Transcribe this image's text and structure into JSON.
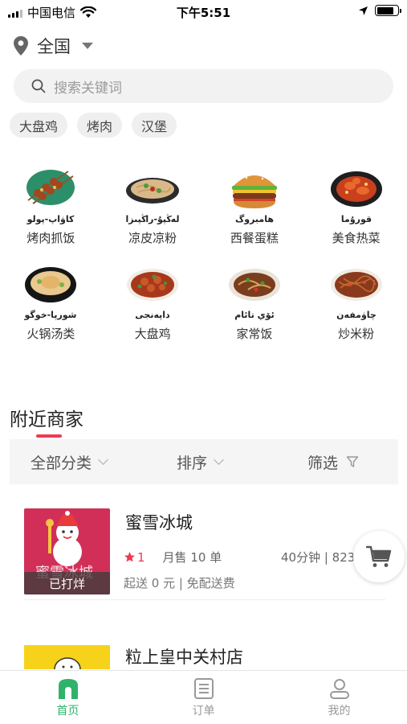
{
  "status_bar": {
    "carrier": "中国电信",
    "time": "下午5:51"
  },
  "location": {
    "city": "全国"
  },
  "search": {
    "placeholder": "搜索关键词"
  },
  "hot_tags": [
    "大盘鸡",
    "烤肉",
    "汉堡"
  ],
  "categories": [
    {
      "label": "烤肉抓饭",
      "uyghur": "كاۋاپ-پولو",
      "icon": "kebab-skewers-icon"
    },
    {
      "label": "凉皮凉粉",
      "uyghur": "لەڭپۇ-راڭپىزا",
      "icon": "cold-noodles-icon"
    },
    {
      "label": "西餐蛋糕",
      "uyghur": "ھامبروگ",
      "icon": "burger-icon"
    },
    {
      "label": "美食热菜",
      "uyghur": "قورۇما",
      "icon": "hot-dish-icon"
    },
    {
      "label": "火锅汤类",
      "uyghur": "شورپا-خوگو",
      "icon": "hotpot-soup-icon"
    },
    {
      "label": "大盘鸡",
      "uyghur": "داپەنجى",
      "icon": "big-plate-chicken-icon"
    },
    {
      "label": "家常饭",
      "uyghur": "ئۆي تائام",
      "icon": "home-meal-icon"
    },
    {
      "label": "炒米粉",
      "uyghur": "چاۋمفەن",
      "icon": "fried-rice-noodle-icon"
    }
  ],
  "section": {
    "title": "附近商家"
  },
  "filters": {
    "category": "全部分类",
    "sort": "排序",
    "filter": "筛选"
  },
  "shops": [
    {
      "name": "蜜雪冰城",
      "thumb_text": "蜜雪冰城",
      "status": "已打烊",
      "rating": "1",
      "sales": "月售 10 单",
      "time_distance": "40分钟 | 823",
      "delivery": "起送 0 元 | 免配送费",
      "thumb_color": "#d12f57"
    },
    {
      "name": "粒上皇中关村店",
      "thumb_color": "#f6d21a"
    }
  ],
  "tabs": [
    {
      "label": "首页",
      "icon": "home-icon",
      "active": true
    },
    {
      "label": "订单",
      "icon": "orders-icon",
      "active": false
    },
    {
      "label": "我的",
      "icon": "profile-icon",
      "active": false
    }
  ],
  "colors": {
    "accent": "#ee3b4f",
    "tab_active": "#2fb36b",
    "search_bg": "#f2f2f2"
  }
}
